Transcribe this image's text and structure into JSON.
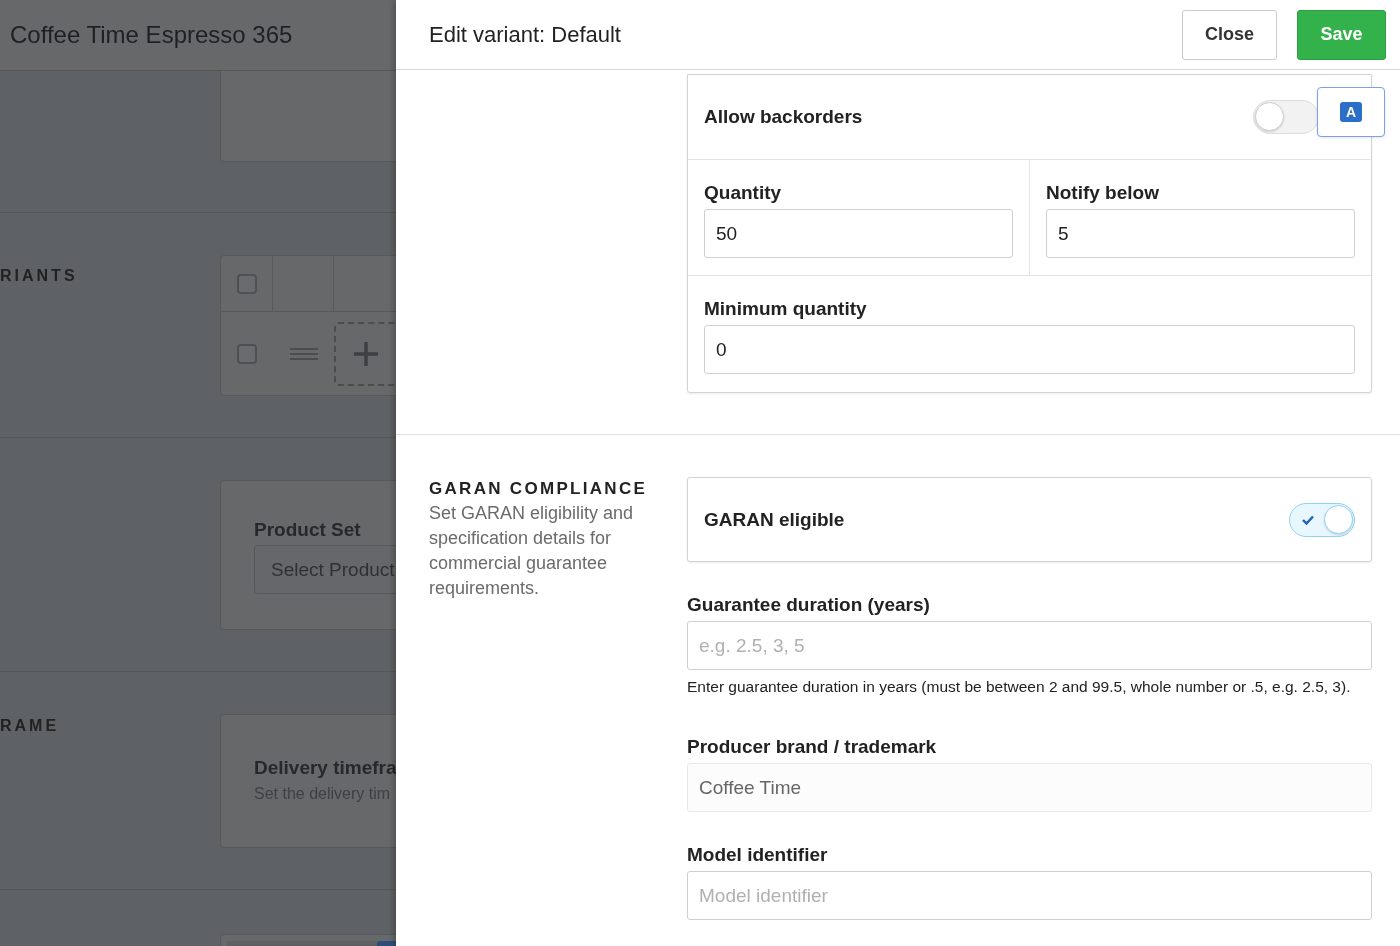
{
  "background": {
    "title": "Coffee Time Espresso 365",
    "variants_label": "RIANTS",
    "variants_table": {
      "header_checked": false,
      "row_checked": false
    },
    "product_set": {
      "label": "Product Set",
      "placeholder": "Select Product"
    },
    "timeframe_label": "RAME",
    "delivery": {
      "title": "Delivery timefra",
      "description": "Set the delivery tim"
    }
  },
  "drawer": {
    "title": "Edit variant: Default",
    "buttons": [
      {
        "label": "Close",
        "kind": "secondary"
      },
      {
        "label": "Save",
        "kind": "primary"
      }
    ],
    "inventory": {
      "backorders": {
        "label": "Allow backorders",
        "on": false
      },
      "translate_badge": "A",
      "fields": [
        {
          "label": "Quantity",
          "value": "50"
        },
        {
          "label": "Notify below",
          "value": "5"
        },
        {
          "label": "Minimum quantity",
          "value": "0"
        }
      ]
    },
    "garan": {
      "heading": "GARAN COMPLIANCE",
      "description": "Set GARAN eligibility and specification details for commercial guarantee requirements.",
      "eligible": {
        "label": "GARAN eligible",
        "on": true
      },
      "fields": [
        {
          "label": "Guarantee duration (years)",
          "placeholder": "e.g. 2.5, 3, 5",
          "help": "Enter guarantee duration in years (must be between 2 and 99.5, whole number or .5, e.g. 2.5, 3).",
          "disabled": false
        },
        {
          "label": "Producer brand / trademark",
          "value": "Coffee Time",
          "disabled": true
        },
        {
          "label": "Model identifier",
          "placeholder": "Model identifier",
          "disabled": false
        }
      ]
    }
  }
}
